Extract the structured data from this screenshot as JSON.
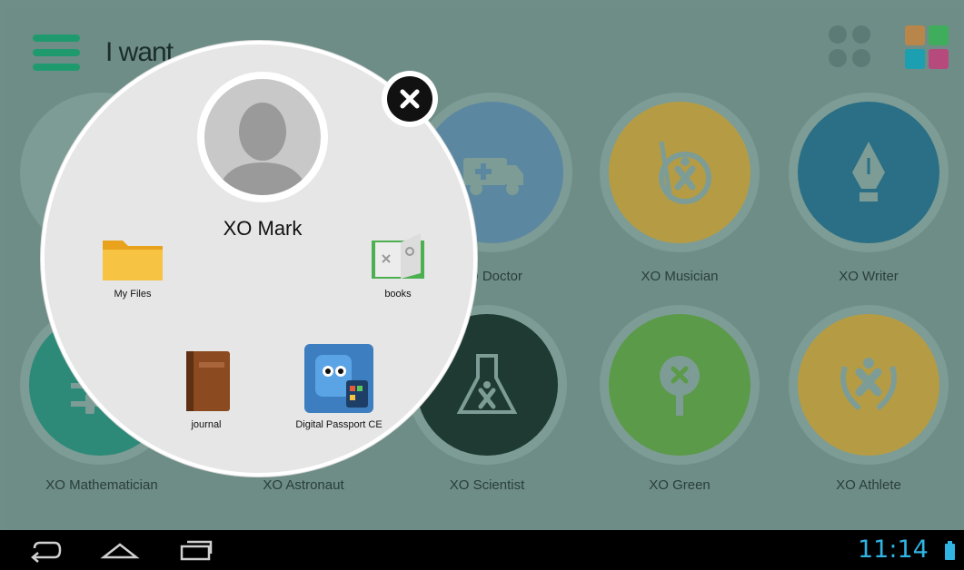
{
  "header": {
    "title": "I want",
    "menu_icon": "hamburger-icon"
  },
  "occupations": [
    {
      "label": "",
      "icon": "blank"
    },
    {
      "label": "",
      "icon": "blank"
    },
    {
      "label": "XO Doctor",
      "icon": "ambulance-icon",
      "color": "#5b9ac0"
    },
    {
      "label": "XO Musician",
      "icon": "music-icon",
      "color": "#d9b83a"
    },
    {
      "label": "XO Writer",
      "icon": "pen-nib-icon",
      "color": "#1a6f8e"
    },
    {
      "label": "XO Mathematician",
      "icon": "slider-icon",
      "color": "#1f9a7f"
    },
    {
      "label": "XO Astronaut",
      "icon": "rocket-icon",
      "color": "#2a4a66"
    },
    {
      "label": "XO Scientist",
      "icon": "flask-icon",
      "color": "#1f3f35"
    },
    {
      "label": "XO Green",
      "icon": "tree-icon",
      "color": "#5fa845"
    },
    {
      "label": "XO Athlete",
      "icon": "laurel-icon",
      "color": "#d9b83a"
    }
  ],
  "profile": {
    "name": "XO Mark",
    "close_icon": "close-icon",
    "apps": [
      {
        "label": "My Files",
        "icon": "folder-icon"
      },
      {
        "label": "books",
        "icon": "book-icon"
      },
      {
        "label": "journal",
        "icon": "journal-icon"
      },
      {
        "label": "Digital Passport CE",
        "icon": "passport-icon"
      }
    ]
  },
  "taskbar": {
    "time": "11:14",
    "back_icon": "back-icon",
    "home_icon": "home-icon",
    "recents_icon": "recents-icon",
    "battery_icon": "battery-icon",
    "accent": "#2fb4e3"
  }
}
